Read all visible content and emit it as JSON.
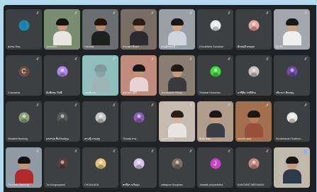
{
  "meeting": {
    "participants": [
      {
        "name": "ສມາຍ ໄຫນ",
        "kind": "avatar",
        "color": "#1e8e9e",
        "icon": "person-icon",
        "glyph": "👤"
      },
      {
        "name": "Janeeeai ... ",
        "kind": "video",
        "skin": "#c59a7c",
        "hair": "#1a1410",
        "shirt": "#e9e6e2",
        "bg": "#7a8d70"
      },
      {
        "name": "Hamzaa",
        "kind": "video",
        "skin": "#b48a6e",
        "hair": "#20140d",
        "shirt": "#1e2020",
        "bg": "#6b6e70"
      },
      {
        "name": "ກາບເສດ ກັນຍາ",
        "kind": "video",
        "skin": "#b38b73",
        "hair": "#2a1d15",
        "shirt": "#2e2a30",
        "bg": "#786e66"
      },
      {
        "name": "ສາຍລັດສະໝີ ...",
        "kind": "video",
        "skin": "#cfa88c",
        "hair": "#1b1714",
        "shirt": "#cfd5de",
        "bg": "#9aa0a6"
      },
      {
        "name": "Chonthicha Somchan",
        "kind": "avatar",
        "color": "#e8eaed",
        "icon": "profile-photo-icon",
        "glyph": ""
      },
      {
        "name": "ທັດສະນີ ທອງສຸກ",
        "kind": "avatar",
        "color": "#e9a3a0",
        "icon": "profile-photo-icon",
        "glyph": ""
      },
      {
        "name": "ກຸ້ງ ກັນ ...",
        "kind": "video",
        "skin": "#caa285",
        "hair": "#181818",
        "shirt": "#efefef",
        "bg": "#a4a8ac"
      },
      {
        "name": "Chanachai",
        "kind": "avatar",
        "color": "#6d4c41",
        "icon": "letter-c-icon",
        "glyph": "C"
      },
      {
        "name": "ສັນທີຟອນ ຈັນທີ້",
        "kind": "avatar",
        "color": "#b088e6",
        "icon": "profile-photo-icon",
        "glyph": ""
      },
      {
        "name": "ແສງສີ ນາງ",
        "kind": "video",
        "skin": "#8aa2a4",
        "hair": "#7f9a9c",
        "shirt": "#9eb3b5",
        "bg": "#8fbfbd"
      },
      {
        "name": "ສະໄໝດ ເບີນີ",
        "kind": "video",
        "skin": "#c29478",
        "hair": "#1b1614",
        "shirt": "#e7d3d3",
        "bg": "#bf8c7e"
      },
      {
        "name": "Jeerapiporn Pitinip...",
        "kind": "video",
        "skin": "#c79a7d",
        "hair": "#231914",
        "shirt": "#3a3a3e",
        "bg": "#8a7e72"
      },
      {
        "name": "Thidarat Homchan",
        "kind": "avatar",
        "color": "#3ddc3d",
        "icon": "profile-photo-icon",
        "glyph": ""
      },
      {
        "name": "ນາຖີ່ທີ່ພ ໄຫທີ່ຣົານ",
        "kind": "avatar",
        "color": "#c9c2be",
        "icon": "profile-photo-icon",
        "glyph": ""
      },
      {
        "name": "ເສີນາຍາ ທັດສະນຸ",
        "kind": "avatar",
        "color": "#6f4ca8",
        "icon": "profile-photo-icon",
        "glyph": ""
      },
      {
        "name": "Nanabet Bentong",
        "kind": "avatar",
        "color": "#8aa07a",
        "icon": "profile-photo-icon",
        "glyph": ""
      },
      {
        "name": "ພາສາໄທ ອີນໂກ່ນປະຍ...",
        "kind": "avatar",
        "color": "#585858",
        "icon": "profile-photo-icon",
        "glyph": ""
      },
      {
        "name": "ທາມຊື ຄາຍສະ",
        "kind": "avatar",
        "color": "#c7c7c7",
        "icon": "profile-photo-icon",
        "glyph": ""
      },
      {
        "name": "Thinala ດາວ",
        "kind": "avatar",
        "color": "#8b5fb8",
        "icon": "profile-photo-icon",
        "glyph": ""
      },
      {
        "name": "Kanitha Ou...",
        "kind": "video",
        "skin": "#d7b39b",
        "hair": "#2a1f19",
        "shirt": "#e7e4e1",
        "bg": "#c7bab0"
      },
      {
        "name": "ອີເວັນ ພ້ອມ",
        "kind": "video",
        "skin": "#c49c80",
        "hair": "#1d1612",
        "shirt": "#3b3e44",
        "bg": "#b09c8a"
      },
      {
        "name": "ຫນາສາ ແສງ",
        "kind": "video",
        "skin": "#b57e60",
        "hair": "#1e1611",
        "shirt": "#9a4f3c",
        "bg": "#a3704f"
      },
      {
        "name": "Suratchanat Chaibum...",
        "kind": "avatar",
        "color": "#e8e6e0",
        "icon": "profile-photo-icon",
        "glyph": ""
      },
      {
        "name": "Paramee Maroeng",
        "kind": "video",
        "skin": "#c29577",
        "hair": "#151211",
        "shirt": "#b02a2a",
        "bg": "#8f9aa4"
      },
      {
        "name": "Tia Kongsupadul",
        "kind": "avatar",
        "color": "#5b3f3a",
        "icon": "profile-photo-icon",
        "glyph": ""
      },
      {
        "name": "CHONLADA",
        "kind": "avatar",
        "color": "#e3c27d",
        "icon": "profile-photo-icon",
        "glyph": ""
      },
      {
        "name": "ອາທີຍາ ແກ້ວກຸ່ນ",
        "kind": "avatar",
        "color": "#d6c7e8",
        "icon": "profile-photo-icon",
        "glyph": ""
      },
      {
        "name": "nattaporn Bunphan",
        "kind": "avatar",
        "color": "#7d6f64",
        "icon": "profile-photo-icon",
        "glyph": ""
      },
      {
        "name": "Jirawath phiyanthikul",
        "kind": "avatar",
        "color": "#cf3fc7",
        "icon": "letter-j-icon",
        "glyph": "J"
      },
      {
        "name": "KANTAPAT MEEMANG",
        "kind": "avatar",
        "color": "#c58a7a",
        "icon": "profile-photo-icon",
        "glyph": ""
      },
      {
        "name": "",
        "kind": "video",
        "skin": "#c59a7c",
        "hair": "#1b1511",
        "shirt": "#2c3948",
        "bg": "#bfb9ac",
        "speaking": true
      }
    ]
  }
}
